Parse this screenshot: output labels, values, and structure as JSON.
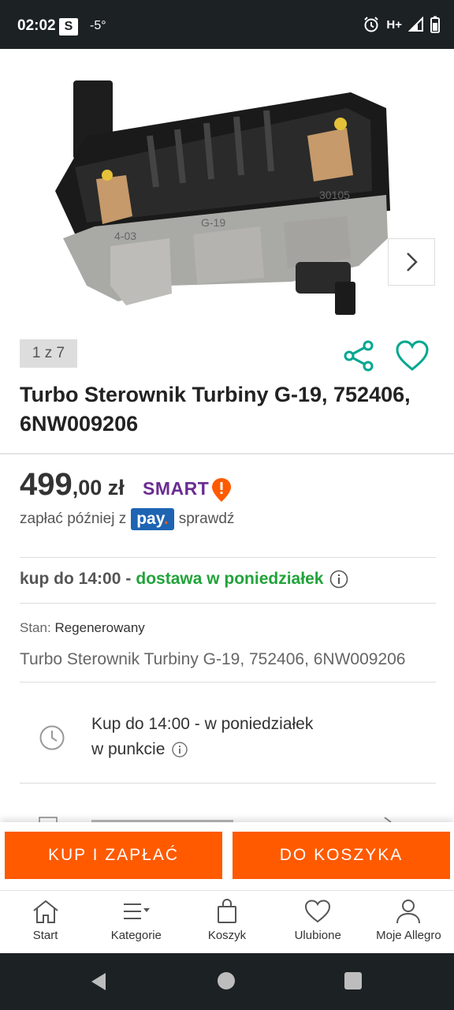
{
  "status_bar": {
    "time": "02:02",
    "app_badge": "S",
    "temperature": "-5°",
    "network": "H+"
  },
  "gallery": {
    "counter": "1 z 7",
    "image_description_icon": "turbo-actuator-photo"
  },
  "product": {
    "title": "Turbo Sterownik Turbiny G-19, 752406, 6NW009206",
    "price_int": "499",
    "price_dec": ",00 zł",
    "smart_label": "SMART",
    "paylater_prefix": "zapłać później z",
    "pay_label": "pay",
    "pay_dot": ".",
    "paylater_link": "sprawdź"
  },
  "delivery": {
    "time": "kup do 14:00",
    "separator": "-",
    "day": "dostawa w poniedziałek"
  },
  "details": {
    "stan_label": "Stan:",
    "stan_value": "Regenerowany",
    "subtitle": "Turbo Sterownik Turbiny G-19, 752406, 6NW009206"
  },
  "pickup": {
    "line1": "Kup do 14:00 - w poniedziałek",
    "line2": "w punkcie"
  },
  "actions": {
    "buy_label": "KUP I ZAPŁAĆ",
    "cart_label": "DO KOSZYKA"
  },
  "bottom_nav": {
    "items": [
      {
        "label": "Start",
        "icon": "home-icon"
      },
      {
        "label": "Kategorie",
        "icon": "menu-icon"
      },
      {
        "label": "Koszyk",
        "icon": "bag-icon"
      },
      {
        "label": "Ulubione",
        "icon": "heart-icon"
      },
      {
        "label": "Moje Allegro",
        "icon": "user-icon"
      }
    ]
  },
  "colors": {
    "accent": "#ff5a00",
    "green": "#21a33a",
    "teal": "#00a790",
    "smart_purple": "#6a2c91",
    "pay_blue": "#1e64b3"
  }
}
